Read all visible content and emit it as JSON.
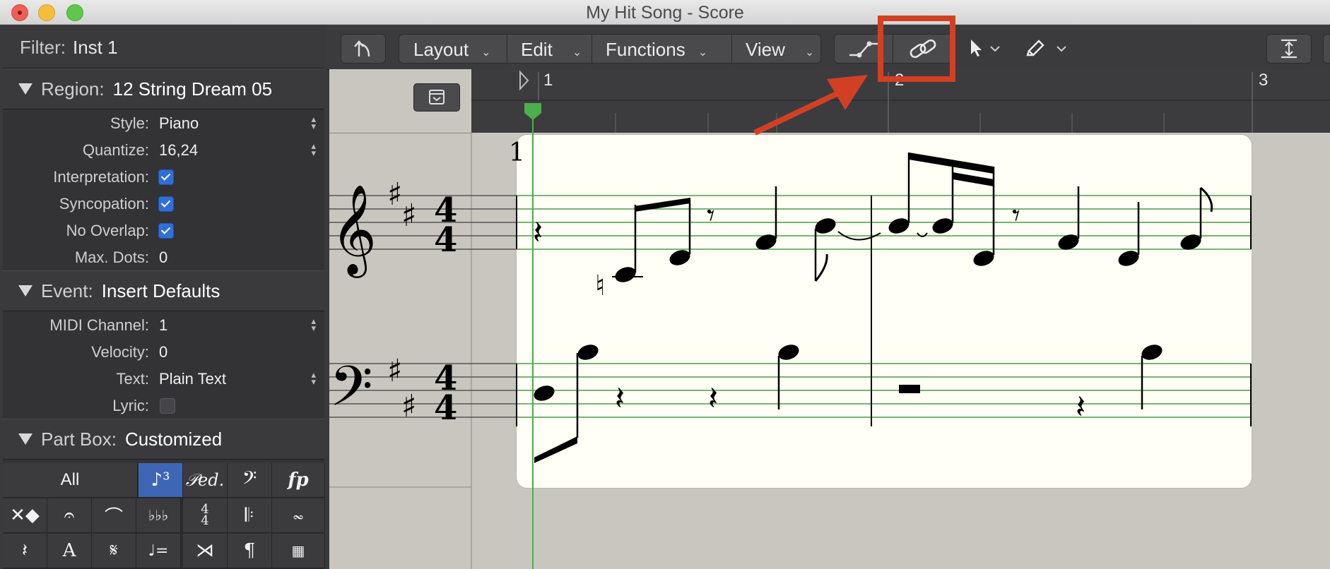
{
  "window": {
    "title": "My Hit Song - Score"
  },
  "inspector": {
    "filter_label": "Filter:",
    "filter_value": "Inst 1",
    "region": {
      "label": "Region:",
      "value": "12 String Dream 05"
    },
    "rows": {
      "style": {
        "label": "Style:",
        "value": "Piano"
      },
      "quantize": {
        "label": "Quantize:",
        "value": "16,24"
      },
      "interpretation": {
        "label": "Interpretation:"
      },
      "syncopation": {
        "label": "Syncopation:"
      },
      "no_overlap": {
        "label": "No Overlap:"
      },
      "max_dots": {
        "label": "Max. Dots:",
        "value": "0"
      }
    },
    "event": {
      "label": "Event:",
      "value": "Insert Defaults"
    },
    "event_rows": {
      "midi_channel": {
        "label": "MIDI Channel:",
        "value": "1"
      },
      "velocity": {
        "label": "Velocity:",
        "value": "0"
      },
      "text": {
        "label": "Text:",
        "value": "Plain Text"
      },
      "lyric": {
        "label": "Lyric:"
      }
    },
    "part_box": {
      "label": "Part Box:",
      "value": "Customized",
      "all_label": "All"
    }
  },
  "toolbar": {
    "layout_label": "Layout",
    "edit_label": "Edit",
    "functions_label": "Functions",
    "view_label": "View"
  },
  "ruler": {
    "bar1": "1",
    "bar2": "2",
    "bar3": "3"
  },
  "score": {
    "measure_number": "1",
    "time_sig_top": "4",
    "time_sig_bottom": "4"
  },
  "colors": {
    "highlight": "#d24024",
    "playhead": "#4cae4c",
    "selected_part": "#3e66b6"
  }
}
